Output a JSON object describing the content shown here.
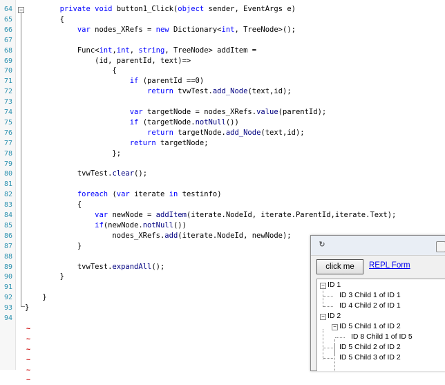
{
  "editor": {
    "lines": [
      {
        "n": "64",
        "parts": [
          [
            "        ",
            "pu"
          ],
          [
            "private",
            "kw"
          ],
          [
            " ",
            "pu"
          ],
          [
            "void",
            "kw"
          ],
          [
            " button1_Click(",
            "pu"
          ],
          [
            "object",
            "kw"
          ],
          [
            " sender, EventArgs e)",
            "pu"
          ]
        ]
      },
      {
        "n": "65",
        "parts": [
          [
            "        {",
            "pu"
          ]
        ]
      },
      {
        "n": "66",
        "parts": [
          [
            "            ",
            "pu"
          ],
          [
            "var",
            "kw"
          ],
          [
            " nodes_XRefs = ",
            "pu"
          ],
          [
            "new",
            "kw"
          ],
          [
            " ",
            "pu"
          ],
          [
            "Dictionary",
            "pu"
          ],
          [
            "<",
            "pu"
          ],
          [
            "int",
            "kw"
          ],
          [
            ", TreeNode>();",
            "pu"
          ]
        ]
      },
      {
        "n": "67",
        "parts": []
      },
      {
        "n": "68",
        "parts": [
          [
            "            Func<",
            "pu"
          ],
          [
            "int",
            "kw"
          ],
          [
            ",",
            "pu"
          ],
          [
            "int",
            "kw"
          ],
          [
            ", ",
            "pu"
          ],
          [
            "string",
            "kw"
          ],
          [
            ", TreeNode> addItem =",
            "pu"
          ]
        ]
      },
      {
        "n": "69",
        "parts": [
          [
            "                (id, parentId, text)=>",
            "pu"
          ]
        ]
      },
      {
        "n": "70",
        "parts": [
          [
            "                    {",
            "pu"
          ]
        ]
      },
      {
        "n": "71",
        "parts": [
          [
            "                        ",
            "pu"
          ],
          [
            "if",
            "kw"
          ],
          [
            " (parentId ==0)",
            "pu"
          ]
        ]
      },
      {
        "n": "72",
        "parts": [
          [
            "                            ",
            "pu"
          ],
          [
            "return",
            "kw"
          ],
          [
            " tvwTest.",
            "pu"
          ],
          [
            "add_Node",
            "fn"
          ],
          [
            "(text,id);",
            "pu"
          ]
        ]
      },
      {
        "n": "73",
        "parts": []
      },
      {
        "n": "74",
        "parts": [
          [
            "                        ",
            "pu"
          ],
          [
            "var",
            "kw"
          ],
          [
            " targetNode = nodes_XRefs.",
            "pu"
          ],
          [
            "value",
            "fn"
          ],
          [
            "(parentId);",
            "pu"
          ]
        ]
      },
      {
        "n": "75",
        "parts": [
          [
            "                        ",
            "pu"
          ],
          [
            "if",
            "kw"
          ],
          [
            " (targetNode.",
            "pu"
          ],
          [
            "notNull",
            "fn"
          ],
          [
            "())",
            "pu"
          ]
        ]
      },
      {
        "n": "76",
        "parts": [
          [
            "                            ",
            "pu"
          ],
          [
            "return",
            "kw"
          ],
          [
            " targetNode.",
            "pu"
          ],
          [
            "add_Node",
            "fn"
          ],
          [
            "(text,id);",
            "pu"
          ]
        ]
      },
      {
        "n": "77",
        "parts": [
          [
            "                        ",
            "pu"
          ],
          [
            "return",
            "kw"
          ],
          [
            " targetNode;",
            "pu"
          ]
        ]
      },
      {
        "n": "78",
        "parts": [
          [
            "                    };",
            "pu"
          ]
        ]
      },
      {
        "n": "79",
        "parts": []
      },
      {
        "n": "80",
        "parts": [
          [
            "            tvwTest.",
            "pu"
          ],
          [
            "clear",
            "fn"
          ],
          [
            "();",
            "pu"
          ]
        ]
      },
      {
        "n": "81",
        "parts": []
      },
      {
        "n": "82",
        "parts": [
          [
            "            ",
            "pu"
          ],
          [
            "foreach",
            "kw"
          ],
          [
            " (",
            "pu"
          ],
          [
            "var",
            "kw"
          ],
          [
            " iterate ",
            "pu"
          ],
          [
            "in",
            "kw"
          ],
          [
            " testinfo)",
            "pu"
          ]
        ]
      },
      {
        "n": "83",
        "parts": [
          [
            "            {",
            "pu"
          ]
        ]
      },
      {
        "n": "84",
        "parts": [
          [
            "                ",
            "pu"
          ],
          [
            "var",
            "kw"
          ],
          [
            " newNode = ",
            "pu"
          ],
          [
            "addItem",
            "fn"
          ],
          [
            "(iterate.NodeId, iterate.ParentId,iterate.Text);",
            "pu"
          ]
        ]
      },
      {
        "n": "85",
        "parts": [
          [
            "                ",
            "pu"
          ],
          [
            "if",
            "kw"
          ],
          [
            "(newNode.",
            "pu"
          ],
          [
            "notNull",
            "fn"
          ],
          [
            "())",
            "pu"
          ]
        ]
      },
      {
        "n": "86",
        "parts": [
          [
            "                    nodes_XRefs.",
            "pu"
          ],
          [
            "add",
            "fn"
          ],
          [
            "(iterate.NodeId, newNode);",
            "pu"
          ]
        ]
      },
      {
        "n": "87",
        "parts": [
          [
            "            }",
            "pu"
          ]
        ]
      },
      {
        "n": "88",
        "parts": []
      },
      {
        "n": "89",
        "parts": [
          [
            "            tvwTest.",
            "pu"
          ],
          [
            "expandAll",
            "fn"
          ],
          [
            "();",
            "pu"
          ]
        ]
      },
      {
        "n": "90",
        "parts": [
          [
            "        }",
            "pu"
          ]
        ]
      },
      {
        "n": "91",
        "parts": []
      },
      {
        "n": "92",
        "parts": [
          [
            "    }",
            "pu"
          ]
        ]
      },
      {
        "n": "93",
        "parts": [
          [
            "}",
            "pu"
          ]
        ]
      },
      {
        "n": "94",
        "parts": []
      }
    ],
    "tildes": [
      "~",
      "~",
      "~",
      "~",
      "~",
      "~"
    ],
    "fold_symbol": "−"
  },
  "form": {
    "icon": "app-icon",
    "click_button_label": "click me",
    "link_label": "REPL Form",
    "tree": [
      {
        "label": "ID 1",
        "level": 0,
        "expander": "−"
      },
      {
        "label": "ID 3 Child 1 of ID 1",
        "level": 1
      },
      {
        "label": "ID 4 Child 2 of ID 1",
        "level": 1
      },
      {
        "label": "ID 2",
        "level": 0,
        "expander": "−"
      },
      {
        "label": "ID 5 Child 1 of ID 2",
        "level": 1,
        "expander": "−"
      },
      {
        "label": "ID 8 Child 1 of ID 5",
        "level": 2
      },
      {
        "label": "ID 5 Child 2 of ID 2",
        "level": 1
      },
      {
        "label": "ID 5 Child 3 of ID 2",
        "level": 1
      }
    ]
  },
  "colors": {
    "keyword": "#0000ff",
    "line_number": "#2b91af",
    "tilde": "#cc0000",
    "link": "#0000ee"
  }
}
